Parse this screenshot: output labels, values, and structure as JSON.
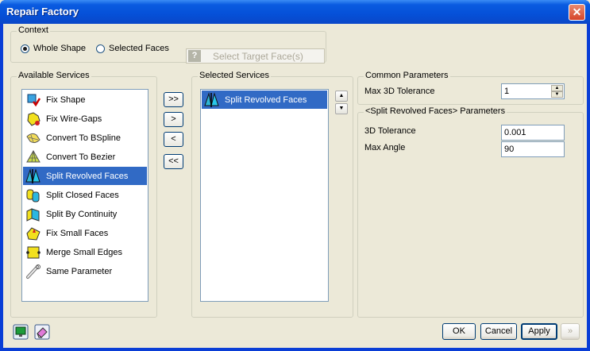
{
  "window": {
    "title": "Repair Factory",
    "close_glyph": "✕"
  },
  "context": {
    "label": "Context",
    "radio_whole": "Whole Shape",
    "radio_selected": "Selected Faces",
    "selected_option": "Whole Shape",
    "target_button": "Select Target Face(s)",
    "target_icon": "help-icon",
    "target_icon_glyph": "?"
  },
  "available": {
    "label": "Available Services",
    "items": [
      {
        "label": "Fix Shape",
        "icon": "fix-shape-icon"
      },
      {
        "label": "Fix Wire-Gaps",
        "icon": "fix-wire-gaps-icon"
      },
      {
        "label": "Convert To BSpline",
        "icon": "convert-bspline-icon"
      },
      {
        "label": "Convert To Bezier",
        "icon": "convert-bezier-icon"
      },
      {
        "label": "Split Revolved Faces",
        "icon": "split-revolved-faces-icon",
        "selected": true
      },
      {
        "label": "Split Closed Faces",
        "icon": "split-closed-faces-icon"
      },
      {
        "label": "Split By Continuity",
        "icon": "split-by-continuity-icon"
      },
      {
        "label": "Fix Small Faces",
        "icon": "fix-small-faces-icon"
      },
      {
        "label": "Merge Small Edges",
        "icon": "merge-small-edges-icon"
      },
      {
        "label": "Same Parameter",
        "icon": "same-parameter-icon"
      }
    ]
  },
  "transfer_buttons": {
    "add_all": ">>",
    "add": ">",
    "remove": "<",
    "remove_all": "<<"
  },
  "selected": {
    "label": "Selected Services",
    "items": [
      {
        "label": "Split Revolved Faces",
        "icon": "split-revolved-faces-icon",
        "selected": true
      }
    ],
    "up_glyph": "▲",
    "down_glyph": "▼"
  },
  "common": {
    "label": "Common Parameters",
    "max_tol_label": "Max 3D Tolerance",
    "max_tol_value": "1",
    "up_glyph": "▲",
    "down_glyph": "▼"
  },
  "split_params": {
    "label": "<Split Revolved Faces> Parameters",
    "tol_label": "3D Tolerance",
    "tol_value": "0.001",
    "angle_label": "Max Angle",
    "angle_value": "90"
  },
  "footer": {
    "left_icons": [
      "display-icon",
      "eraser-icon"
    ],
    "ok": "OK",
    "cancel": "Cancel",
    "apply": "Apply",
    "next": "»"
  },
  "colors": {
    "titlebar": "#0550d8",
    "selection": "#316ac5",
    "face": "#ece9d8"
  }
}
